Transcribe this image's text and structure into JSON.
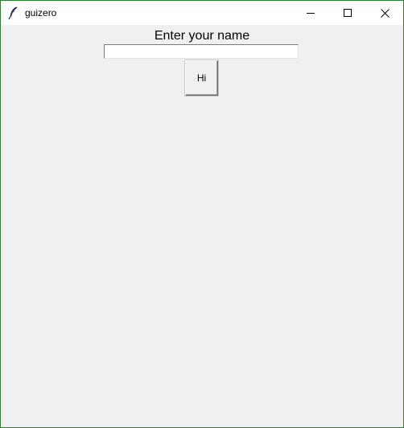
{
  "window": {
    "title": "guizero",
    "icon": "feather-icon",
    "controls": {
      "minimize_icon": "minimize-icon",
      "maximize_icon": "maximize-icon",
      "close_icon": "close-icon"
    }
  },
  "form": {
    "prompt": "Enter your name",
    "name_value": "",
    "button_label": "Hi"
  },
  "colors": {
    "window_border": "#2e7d32",
    "titlebar_bg": "#ffffff",
    "content_bg": "#f0f0f0"
  }
}
